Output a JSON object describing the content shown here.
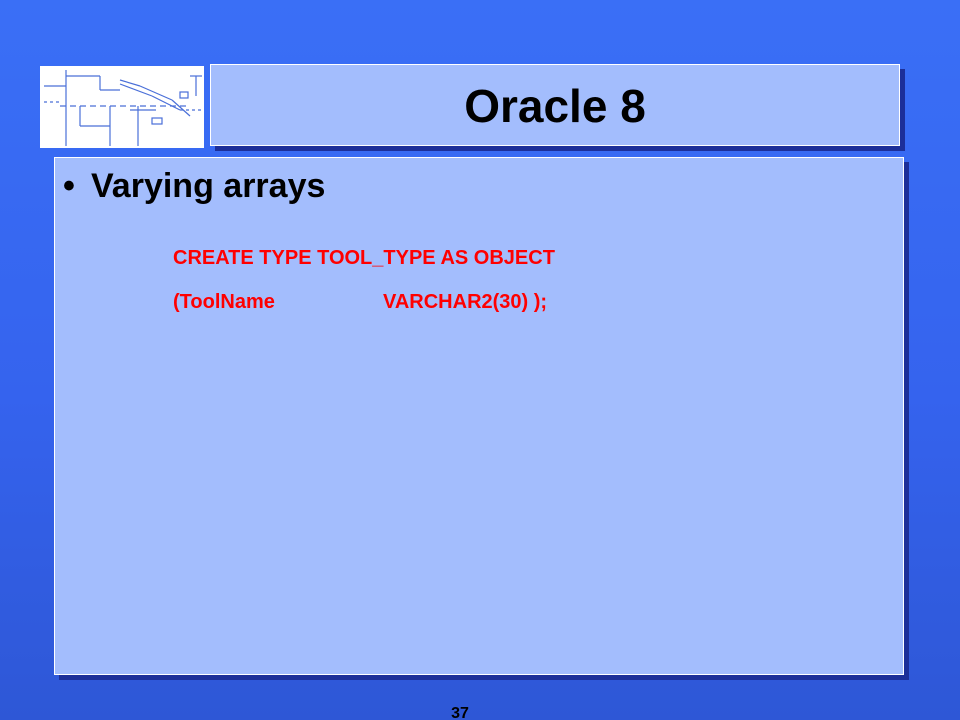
{
  "slide": {
    "title": "Oracle 8",
    "bullet_symbol": "•",
    "bullet_text": "Varying arrays",
    "code_line1": "CREATE TYPE TOOL_TYPE AS OBJECT",
    "code_line2_col1": "(ToolName",
    "code_line2_col2": "VARCHAR2(30) );",
    "page_number": "37"
  },
  "colors": {
    "background": "#3563ee",
    "panel": "#a3bdfd",
    "panel_shadow": "#1c2f99",
    "code_text": "#ff0000",
    "title_text": "#000000"
  },
  "icons": {
    "logo": "circuit-diagram-logo"
  }
}
